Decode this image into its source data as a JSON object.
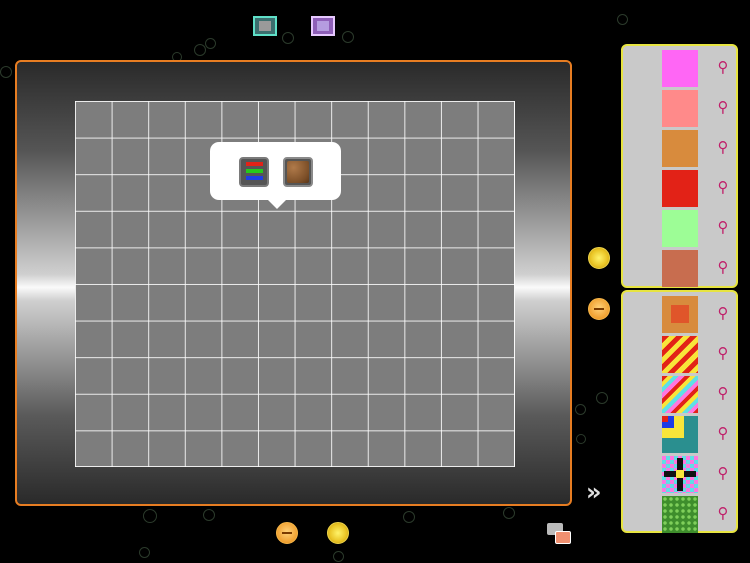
{
  "toolbar": {
    "mode_single": "single-tile-icon",
    "mode_multi": "multi-tile-icon"
  },
  "popover": {
    "color_mode": "rgb-bars-icon",
    "texture_mode": "dirt-texture-icon"
  },
  "controls": {
    "zoom_in": "zoom-in-icon",
    "zoom_out": "zoom-out-icon",
    "bottom_minus": "minus-icon",
    "bottom_plus": "plus-icon",
    "collapse": "»"
  },
  "colors_panel": {
    "swatches": [
      "#ff66f5",
      "#ff8a8a",
      "#d88b3d",
      "#e22217",
      "#9dfd96",
      "#c86d4f"
    ],
    "pin_icon": "pin-icon"
  },
  "patterns_panel": {
    "patterns": [
      "orange-square-pattern",
      "red-yellow-diagonal-pattern",
      "rainbow-diagonal-pattern",
      "teal-corner-pattern",
      "black-cross-pattern",
      "green-dot-pattern"
    ],
    "pin_icon": "pin-icon"
  },
  "accent": {
    "board_border": "#e77d22",
    "panel_border": "#e7e441"
  }
}
